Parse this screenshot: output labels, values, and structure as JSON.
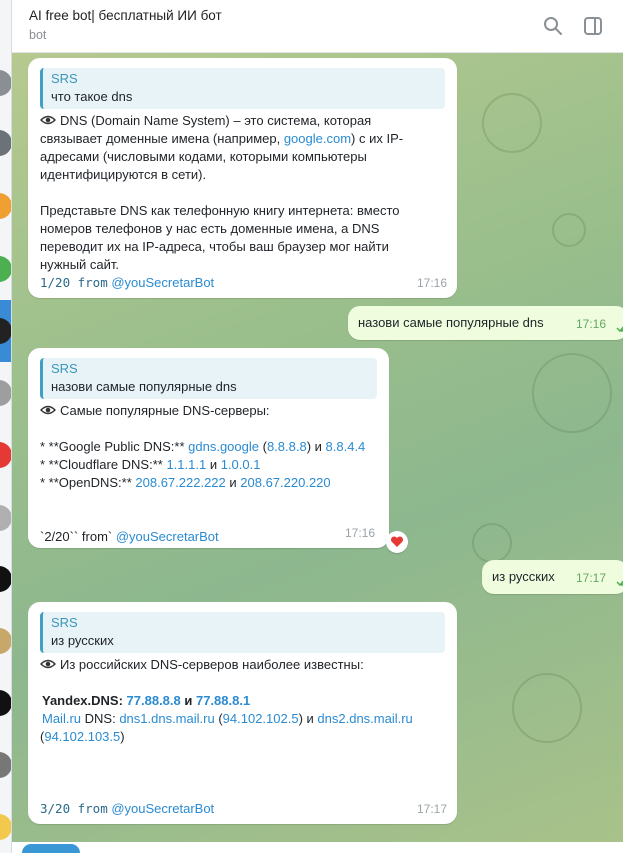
{
  "header": {
    "title": "AI free bot| бесплатный ИИ бот",
    "subtitle": "bot"
  },
  "messages": [
    {
      "quote_author": "SRS",
      "quote_text": "что такое dns",
      "lines": [
        "DNS (Domain Name System) – это система, которая",
        "связывает доменные имена (например, ",
        "google.com",
        ") с их IP-",
        "адресами (числовыми кодами, которыми компьютеры",
        "идентифицируются в сети).",
        "Представьте DNS как телефонную книгу интернета: вместо",
        "номеров телефонов у нас есть доменные имена, а DNS",
        "переводит их на IP-адреса, чтобы ваш браузер мог найти",
        "нужный сайт."
      ],
      "counter": "1/20 from",
      "bot_handle": "@youSecretarBot",
      "time": "17:16"
    },
    {
      "text": "назови самые популярные  dns",
      "time": "17:16"
    },
    {
      "quote_author": "SRS",
      "quote_text": "назови самые популярные  dns",
      "heading": "Самые популярные DNS-серверы:",
      "rows": [
        {
          "prefix": "* **Google Public DNS:** ",
          "a": "gdns.google",
          "b_open": " (",
          "c": "8.8.8.8",
          "d": ") и ",
          "e": "8.8.4.4"
        },
        {
          "prefix": "* **Cloudflare DNS:** ",
          "a": "1.1.1.1",
          "mid": " и ",
          "c": "1.0.0.1"
        },
        {
          "prefix": "* **OpenDNS:** ",
          "a": "208.67.222.222",
          "mid": " и ",
          "c": "208.67.220.220"
        }
      ],
      "footer_prefix": "`2/20`` from` ",
      "bot_handle": "@youSecretarBot",
      "time": "17:16",
      "reaction": "heart"
    },
    {
      "text": "из русских",
      "time": "17:17"
    },
    {
      "quote_author": "SRS",
      "quote_text": "из русских",
      "heading": "Из российских DNS-серверов наиболее известны:",
      "yandex_label": "Yandex.DNS: ",
      "yandex_ip1": "77.88.8.8",
      "yandex_and": " и ",
      "yandex_ip2": "77.88.8.1",
      "mail_link": "Mail.ru",
      "mail_dns": " DNS: ",
      "mail_host1": "dns1.dns.mail.ru",
      "mail_ip1": "94.102.102.5",
      "mail_and": " и ",
      "mail_host2": "dns2.dns.mail.ru",
      "mail_ip2": "94.102.103.5",
      "counter": "3/20 from",
      "bot_handle": "@youSecretarBot",
      "time": "17:17"
    }
  ],
  "colors": {
    "accent": "#3a97b9",
    "link": "#2a8bd1",
    "outgoing_bubble": "#effdde",
    "reaction_heart": "#e53935"
  }
}
